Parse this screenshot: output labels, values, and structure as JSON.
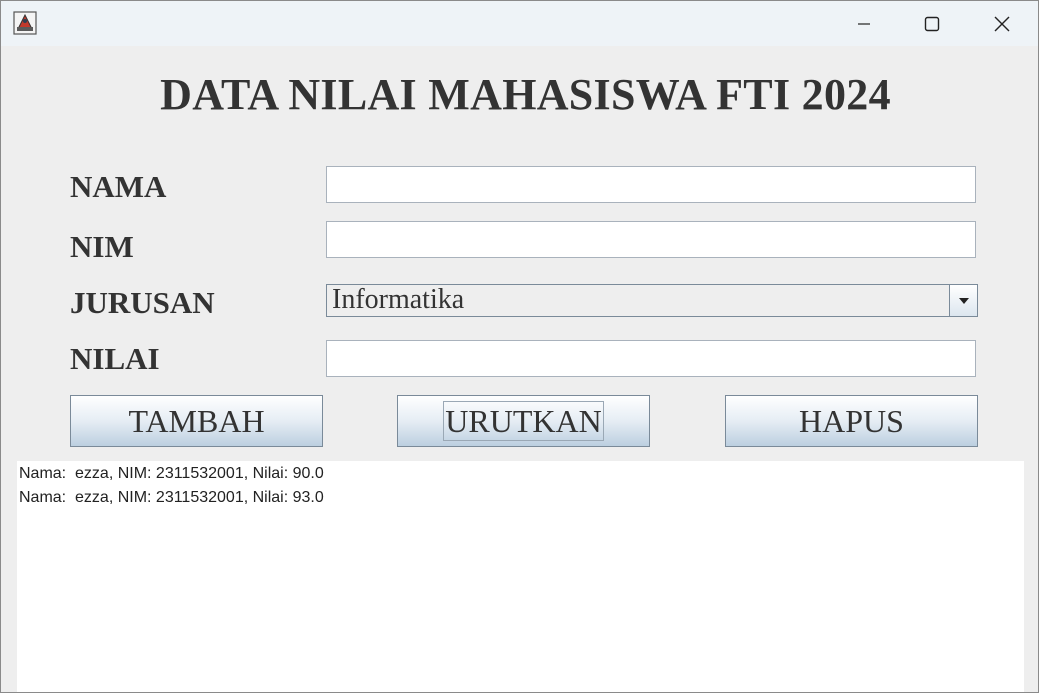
{
  "window": {
    "title": "",
    "app_icon": "java-app-icon",
    "controls": {
      "minimize_icon": "minimize-icon",
      "maximize_icon": "maximize-icon",
      "close_icon": "close-icon"
    }
  },
  "heading": "DATA NILAI MAHASISWA FTI 2024",
  "form": {
    "nama_label": "NAMA",
    "nama_value": "",
    "nim_label": "NIM",
    "nim_value": "",
    "jurusan_label": "JURUSAN",
    "jurusan_selected": "Informatika",
    "nilai_label": "NILAI",
    "nilai_value": ""
  },
  "buttons": {
    "tambah": "TAMBAH",
    "urutkan": "URUTKAN",
    "hapus": "HAPUS"
  },
  "output": {
    "lines": [
      "Nama:  ezza, NIM: 2311532001, Nilai: 90.0",
      "Nama:  ezza, NIM: 2311532001, Nilai: 93.0"
    ]
  }
}
